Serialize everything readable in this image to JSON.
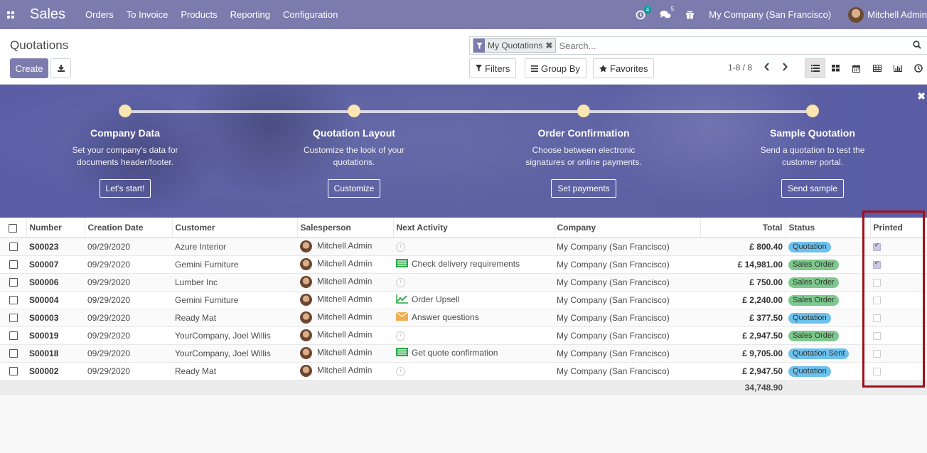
{
  "navbar": {
    "app_name": "Sales",
    "menu": [
      "Orders",
      "To Invoice",
      "Products",
      "Reporting",
      "Configuration"
    ],
    "activity_count": "4",
    "message_count": "5",
    "company": "My Company (San Francisco)",
    "user": "Mitchell Admin"
  },
  "control_panel": {
    "breadcrumb": "Quotations",
    "create_label": "Create",
    "facet_label": "My Quotations",
    "search_placeholder": "Search...",
    "filters_label": "Filters",
    "groupby_label": "Group By",
    "favorites_label": "Favorites",
    "pager": "1-8 / 8"
  },
  "banner": {
    "steps": [
      {
        "title": "Company Data",
        "desc": "Set your company's data for documents header/footer.",
        "button": "Let's start!"
      },
      {
        "title": "Quotation Layout",
        "desc": "Customize the look of your quotations.",
        "button": "Customize"
      },
      {
        "title": "Order Confirmation",
        "desc": "Choose between electronic signatures or online payments.",
        "button": "Set payments"
      },
      {
        "title": "Sample Quotation",
        "desc": "Send a quotation to test the customer portal.",
        "button": "Send sample"
      }
    ]
  },
  "table": {
    "columns": [
      "Number",
      "Creation Date",
      "Customer",
      "Salesperson",
      "Next Activity",
      "Company",
      "Total",
      "Status",
      "Printed"
    ],
    "rows": [
      {
        "number": "S00023",
        "date": "09/29/2020",
        "customer": "Azure Interior",
        "salesperson": "Mitchell Admin",
        "activity": "",
        "activity_icon": "clock",
        "company": "My Company (San Francisco)",
        "total": "£ 800.40",
        "status": "Quotation",
        "printed": true
      },
      {
        "number": "S00007",
        "date": "09/29/2020",
        "customer": "Gemini Furniture",
        "salesperson": "Mitchell Admin",
        "activity": "Check delivery requirements",
        "activity_icon": "list",
        "company": "My Company (San Francisco)",
        "total": "£ 14,981.00",
        "status": "Sales Order",
        "printed": true
      },
      {
        "number": "S00006",
        "date": "09/29/2020",
        "customer": "Lumber Inc",
        "salesperson": "Mitchell Admin",
        "activity": "",
        "activity_icon": "clock",
        "company": "My Company (San Francisco)",
        "total": "£ 750.00",
        "status": "Sales Order",
        "printed": false
      },
      {
        "number": "S00004",
        "date": "09/29/2020",
        "customer": "Gemini Furniture",
        "salesperson": "Mitchell Admin",
        "activity": "Order Upsell",
        "activity_icon": "chart",
        "company": "My Company (San Francisco)",
        "total": "£ 2,240.00",
        "status": "Sales Order",
        "printed": false
      },
      {
        "number": "S00003",
        "date": "09/29/2020",
        "customer": "Ready Mat",
        "salesperson": "Mitchell Admin",
        "activity": "Answer questions",
        "activity_icon": "envelope",
        "company": "My Company (San Francisco)",
        "total": "£ 377.50",
        "status": "Quotation",
        "printed": false
      },
      {
        "number": "S00019",
        "date": "09/29/2020",
        "customer": "YourCompany, Joel Willis",
        "salesperson": "Mitchell Admin",
        "activity": "",
        "activity_icon": "clock",
        "company": "My Company (San Francisco)",
        "total": "£ 2,947.50",
        "status": "Sales Order",
        "printed": false
      },
      {
        "number": "S00018",
        "date": "09/29/2020",
        "customer": "YourCompany, Joel Willis",
        "salesperson": "Mitchell Admin",
        "activity": "Get quote confirmation",
        "activity_icon": "list",
        "company": "My Company (San Francisco)",
        "total": "£ 9,705.00",
        "status": "Quotation Sent",
        "printed": false
      },
      {
        "number": "S00002",
        "date": "09/29/2020",
        "customer": "Ready Mat",
        "salesperson": "Mitchell Admin",
        "activity": "",
        "activity_icon": "clock",
        "company": "My Company (San Francisco)",
        "total": "£ 2,947.50",
        "status": "Quotation",
        "printed": false
      }
    ],
    "sum_total": "34,748.90"
  },
  "colors": {
    "brand": "#7c7bad",
    "quotation_badge": "#6cc1ed",
    "sales_order_badge": "#7dc88c",
    "highlight": "#a0101a"
  }
}
